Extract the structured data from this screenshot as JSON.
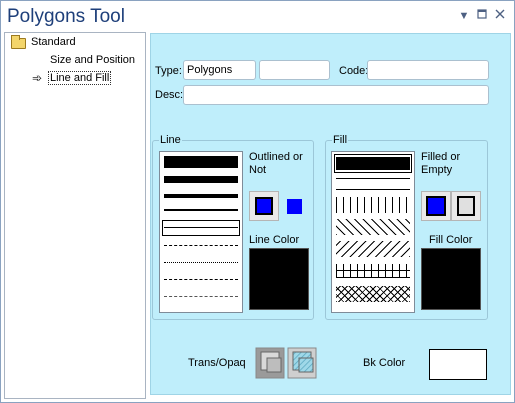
{
  "window": {
    "title": "Polygons Tool",
    "icons": [
      "dropdown-arrow-icon",
      "restore-icon",
      "close-icon"
    ]
  },
  "tree": {
    "root_label": "Standard",
    "children": [
      {
        "label": "Size and Position",
        "selected": false
      },
      {
        "label": "Line and Fill",
        "selected": true
      }
    ]
  },
  "form": {
    "type_label": "Type:",
    "type_value": "Polygons",
    "type2_value": "",
    "code_label": "Code:",
    "code_value": "",
    "desc_label": "Desc:",
    "desc_value": ""
  },
  "line": {
    "group_label": "Line",
    "outlined_label": "Outlined or Not",
    "color_label": "Line Color",
    "outline_color": "#0000ff",
    "line_color": "#000000"
  },
  "fill": {
    "group_label": "Fill",
    "filled_label": "Filled or Empty",
    "color_label": "Fill Color",
    "filled_color": "#0000ff",
    "fill_color": "#000000"
  },
  "bottom": {
    "trans_label": "Trans/Opaq",
    "bk_label": "Bk Color",
    "bk_color": "#ffffff"
  }
}
